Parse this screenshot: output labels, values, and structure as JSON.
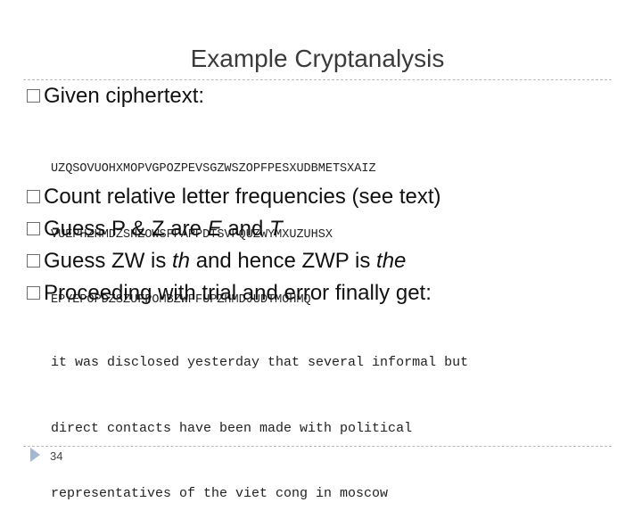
{
  "title": "Example Cryptanalysis",
  "bullets": {
    "given": "Given ciphertext:",
    "count": "Count relative letter frequencies (see text)",
    "guess1": {
      "a": "Guess P & Z are ",
      "b": "E",
      "c": " and ",
      "d": "T"
    },
    "guess2": {
      "a": "Guess ZW is ",
      "b": "th",
      "c": " and hence ZWP is ",
      "d": "the"
    },
    "proceed": "Proceeding with trial and error finally get:"
  },
  "ciphertext": [
    "UZQSOVUOHXMOPVGPOZPEVSGZWSZOPFPESXUDBMETSXAIZ",
    "VUEPHZHMDZSHZOWSFPAPPDTSVPQUZWYMXUZUHSX",
    "EPYEPOPDZSZUFPOMBZWPFUPZHMDJUDTMOHMQ"
  ],
  "plaintext": [
    "it was disclosed yesterday that several informal but",
    "direct contacts have been made with political",
    "representatives of the viet cong in moscow"
  ],
  "footer": {
    "slide_number": "34",
    "icon": "triangle-marker-icon",
    "accent_color": "#a3b7cf"
  }
}
